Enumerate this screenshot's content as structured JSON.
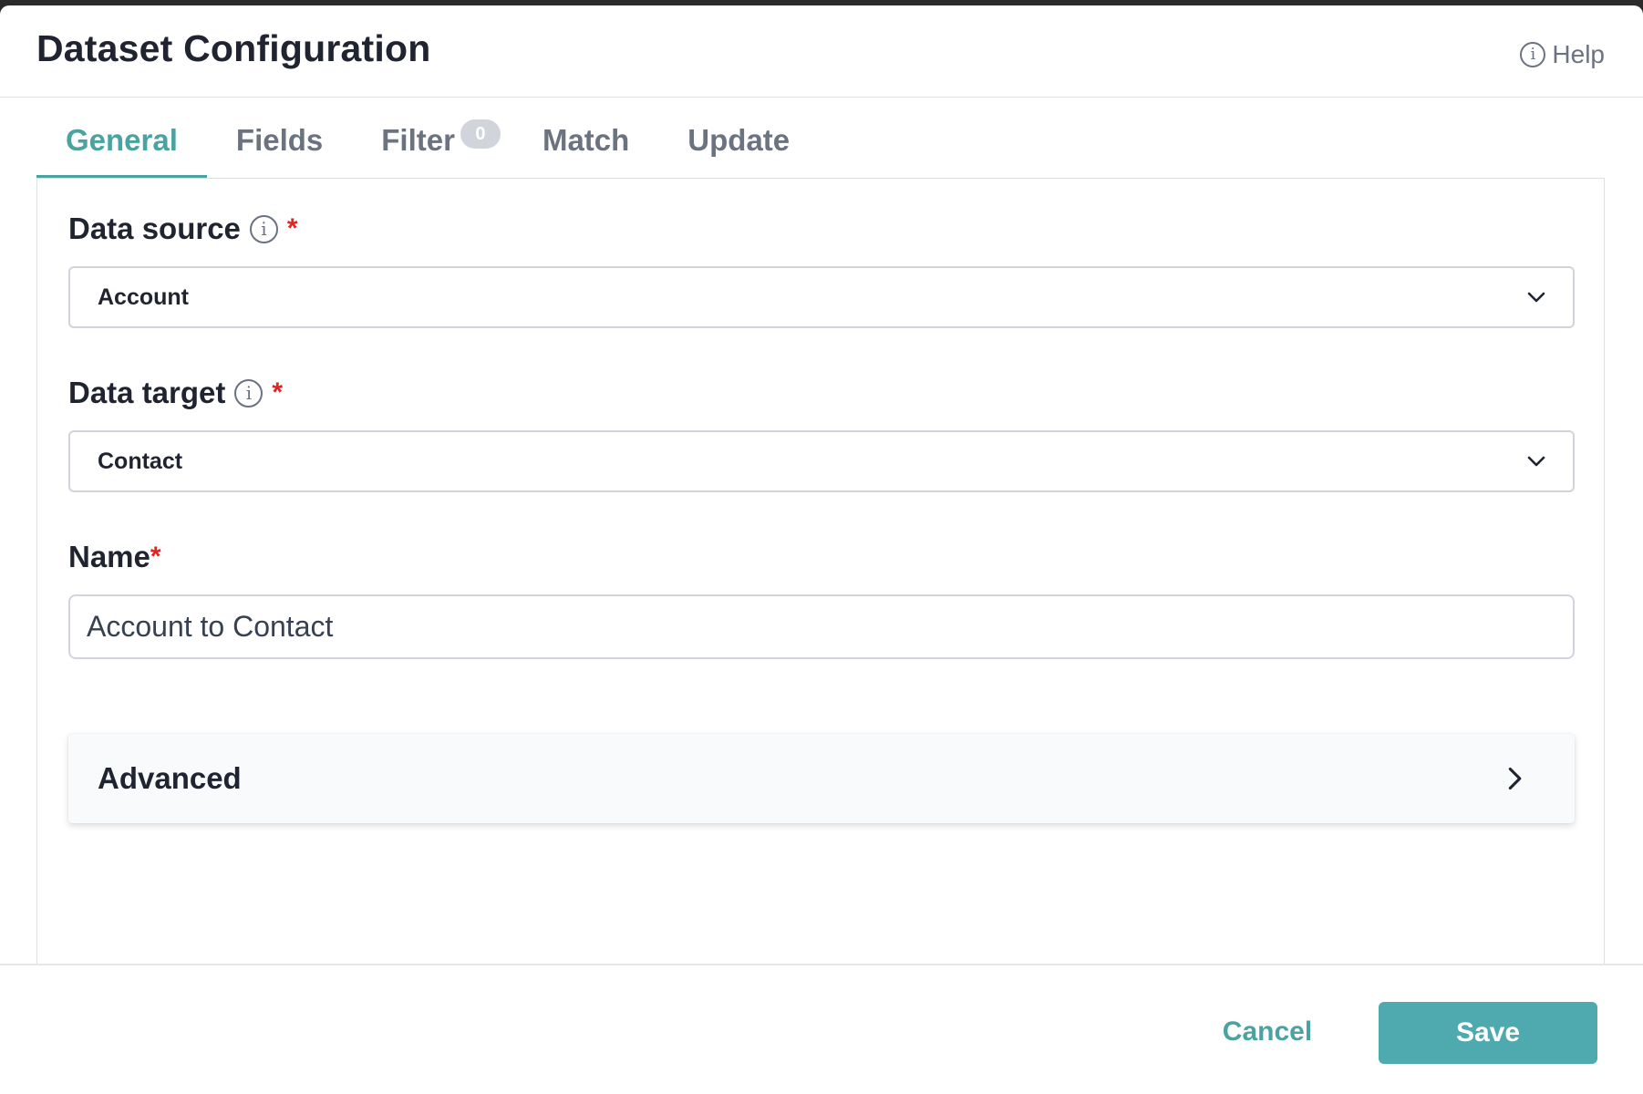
{
  "dialog": {
    "title": "Dataset Configuration",
    "help_label": "Help"
  },
  "tabs": [
    {
      "label": "General",
      "active": true
    },
    {
      "label": "Fields",
      "active": false
    },
    {
      "label": "Filter",
      "active": false,
      "badge": "0"
    },
    {
      "label": "Match",
      "active": false
    },
    {
      "label": "Update",
      "active": false
    }
  ],
  "form": {
    "data_source": {
      "label": "Data source",
      "required_mark": "*",
      "value": "Account"
    },
    "data_target": {
      "label": "Data target",
      "required_mark": "*",
      "value": "Contact"
    },
    "name": {
      "label": "Name",
      "required_mark": "*",
      "value": "Account to Contact"
    }
  },
  "advanced": {
    "label": "Advanced",
    "expanded": false
  },
  "footer": {
    "cancel_label": "Cancel",
    "save_label": "Save"
  },
  "icons": {
    "help": "info-icon",
    "field_info": "info-icon",
    "select_toggle": "chevron-down-icon",
    "accordion_toggle": "chevron-right-icon"
  },
  "colors": {
    "accent": "#4aa3a0",
    "save_button": "#4eaaae",
    "required": "#e02424",
    "badge": "#d1d5db"
  }
}
